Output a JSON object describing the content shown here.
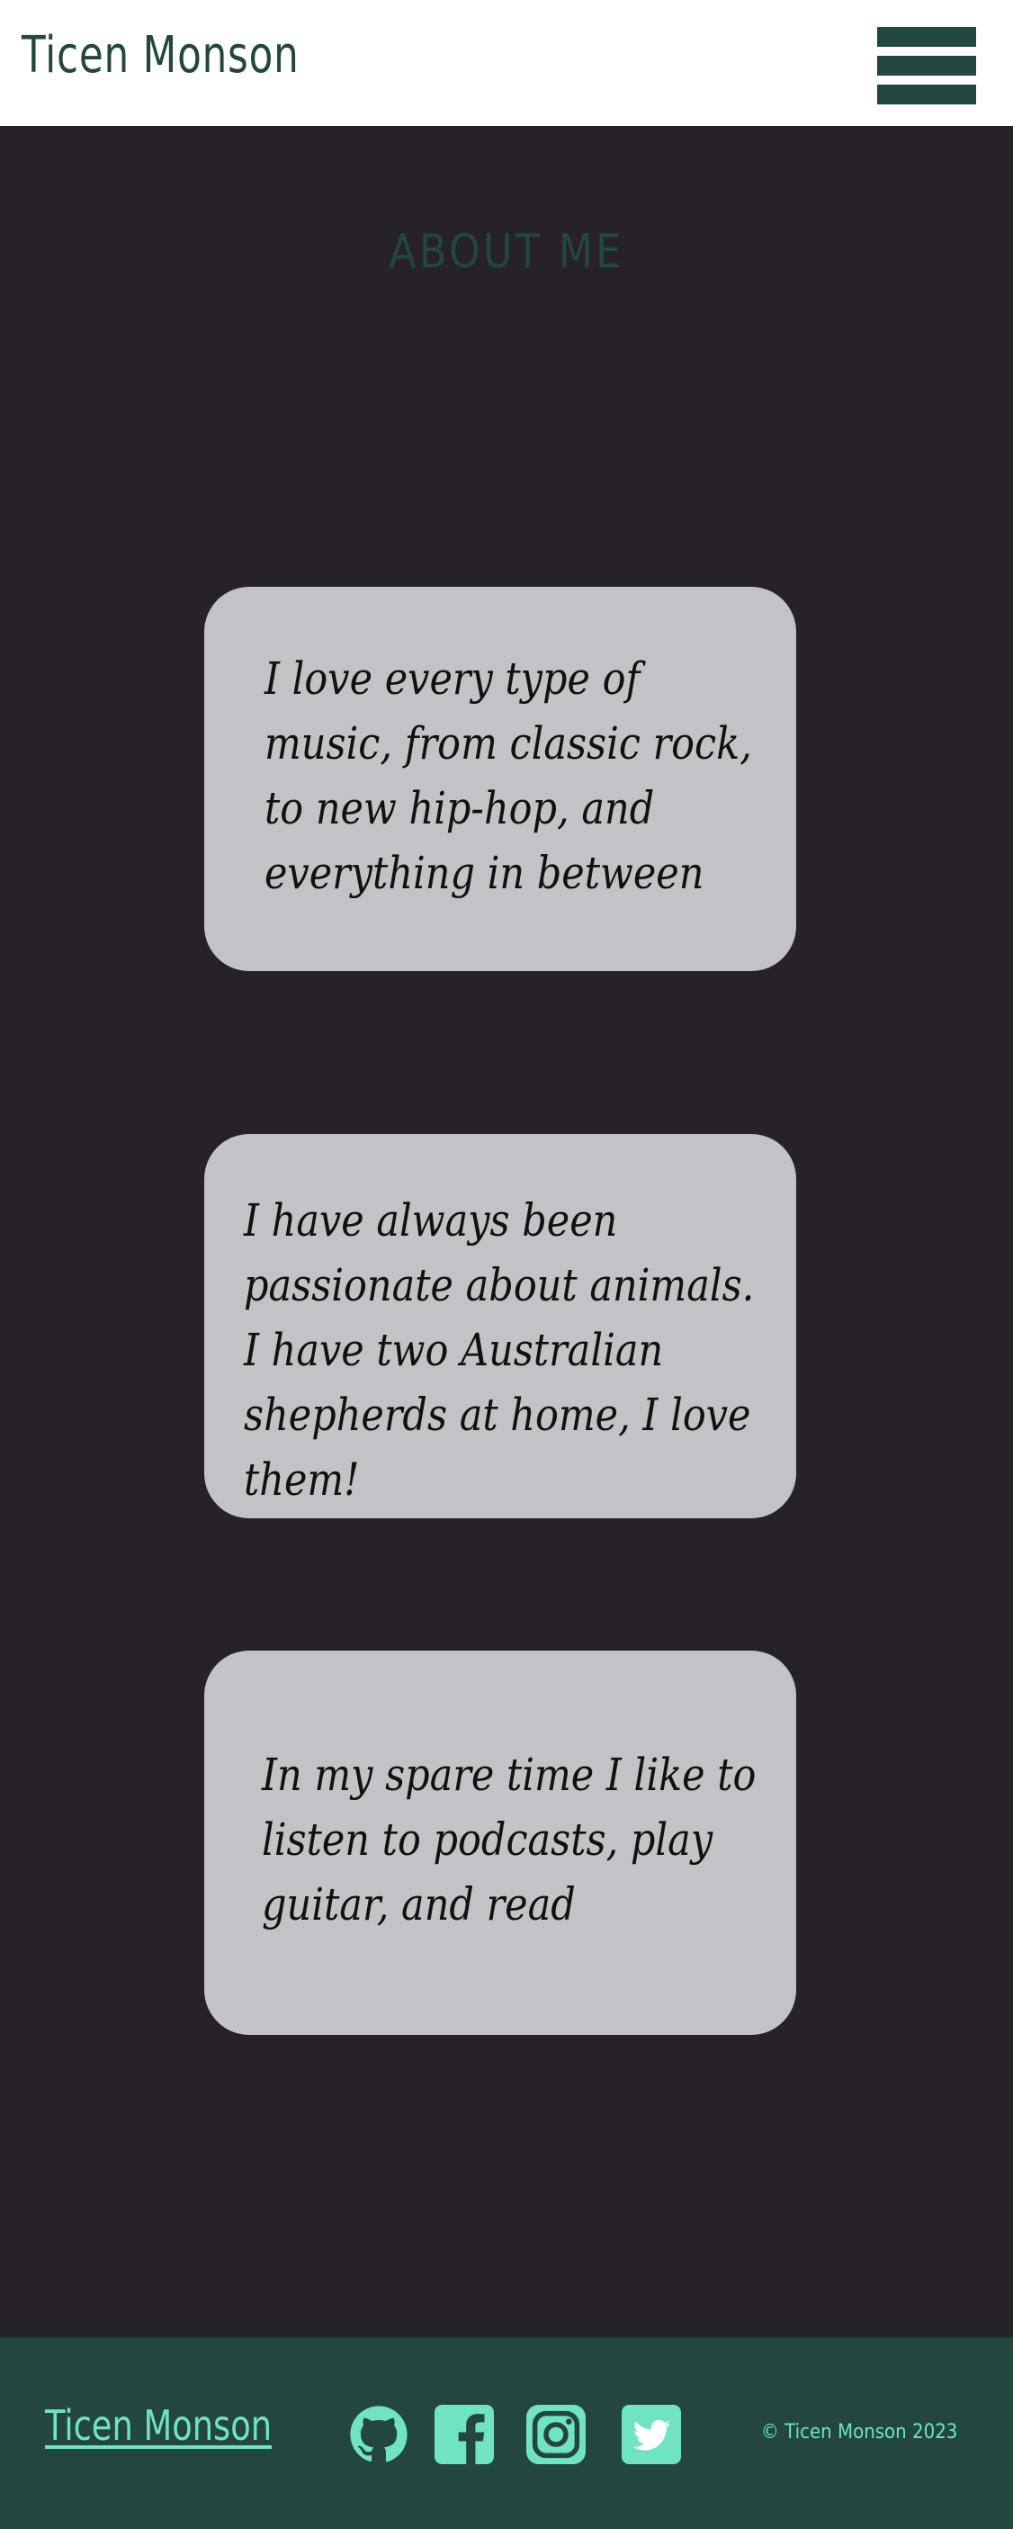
{
  "header": {
    "brand": "Ticen Monson",
    "menu_icon": "hamburger-menu-icon"
  },
  "about": {
    "title": "ABOUT ME",
    "cards": [
      {
        "text": "I love every type of music, from classic rock, to new hip-hop, and everything in between"
      },
      {
        "text": "I have always been passionate about animals. I have two Australian shepherds at home, I love them!"
      },
      {
        "text": "In my spare time I like to listen to podcasts, play guitar, and read"
      }
    ]
  },
  "footer": {
    "brand": "Ticen Monson",
    "social_icons": [
      "github-icon",
      "facebook-icon",
      "instagram-icon",
      "twitter-icon"
    ],
    "copyright": "© Ticen Monson 2023"
  },
  "colors": {
    "background": "#262228",
    "brand_green": "#23463f",
    "accent_mint": "#6fe3c2",
    "card": "#c4c2c6"
  }
}
